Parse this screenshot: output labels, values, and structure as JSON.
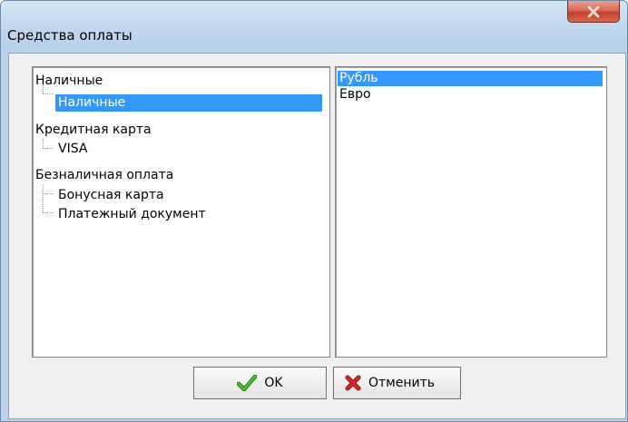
{
  "window": {
    "title": "Средства оплаты"
  },
  "tree": {
    "items": [
      {
        "label": "Наличные",
        "level": 0,
        "selected": false
      },
      {
        "label": "Наличные",
        "level": 1,
        "selected": true
      },
      {
        "label": "Кредитная карта",
        "level": 0,
        "selected": false
      },
      {
        "label": "VISA",
        "level": 1,
        "selected": false
      },
      {
        "label": "Безналичная оплата",
        "level": 0,
        "selected": false
      },
      {
        "label": "Бонусная карта",
        "level": 1,
        "selected": false
      },
      {
        "label": "Платежный документ",
        "level": 1,
        "selected": false
      }
    ]
  },
  "currencies": {
    "items": [
      {
        "label": "Рубль",
        "selected": true
      },
      {
        "label": "Евро",
        "selected": false
      }
    ]
  },
  "buttons": {
    "ok_label": "OK",
    "cancel_label": "Отменить"
  },
  "colors": {
    "selection": "#3399ff",
    "close_button": "#c3412a",
    "ok_icon": "#2e9a1d",
    "cancel_icon": "#c8241b"
  },
  "icons": {
    "close": "close-icon",
    "ok": "checkmark-icon",
    "cancel": "cross-icon"
  }
}
